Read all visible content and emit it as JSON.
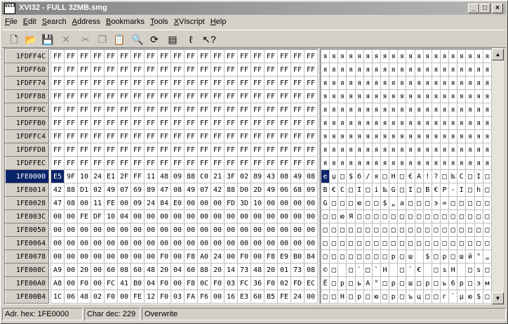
{
  "window": {
    "title": "XVI32 - FULL 32MB.smg",
    "app_icon_text": "XVI32"
  },
  "menu": [
    "File",
    "Edit",
    "Search",
    "Address",
    "Bookmarks",
    "Tools",
    "XVIscript",
    "Help"
  ],
  "toolbar": [
    {
      "name": "new-file-icon",
      "glyph": "🗋",
      "enabled": true
    },
    {
      "name": "open-folder-icon",
      "glyph": "📂",
      "enabled": true
    },
    {
      "name": "save-icon",
      "glyph": "💾",
      "enabled": true
    },
    {
      "name": "close-icon",
      "glyph": "✕",
      "enabled": false
    },
    {
      "name": "cut-icon",
      "glyph": "✂",
      "enabled": false
    },
    {
      "name": "copy-icon",
      "glyph": "❐",
      "enabled": false
    },
    {
      "name": "paste-icon",
      "glyph": "📋",
      "enabled": false
    },
    {
      "name": "search-icon",
      "glyph": "🔍",
      "enabled": true
    },
    {
      "name": "replace-icon",
      "glyph": "⟳",
      "enabled": true
    },
    {
      "name": "properties-icon",
      "glyph": "▤",
      "enabled": true
    },
    {
      "name": "script-icon",
      "glyph": "ℓ",
      "enabled": true
    },
    {
      "name": "help-icon",
      "glyph": "↖?",
      "enabled": true
    }
  ],
  "current_row": 9,
  "current_col": 0,
  "rows": [
    {
      "addr": "1FDFF4C",
      "hex": [
        "FF",
        "FF",
        "FF",
        "FF",
        "FF",
        "FF",
        "FF",
        "FF",
        "FF",
        "FF",
        "FF",
        "FF",
        "FF",
        "FF",
        "FF",
        "FF",
        "FF",
        "FF",
        "FF",
        "FF"
      ],
      "ascii": [
        "я",
        "я",
        "я",
        "я",
        "я",
        "я",
        "я",
        "я",
        "я",
        "я",
        "я",
        "я",
        "я",
        "я",
        "я",
        "я",
        "я",
        "я",
        "я",
        "я"
      ]
    },
    {
      "addr": "1FDFF60",
      "hex": [
        "FF",
        "FF",
        "FF",
        "FF",
        "FF",
        "FF",
        "FF",
        "FF",
        "FF",
        "FF",
        "FF",
        "FF",
        "FF",
        "FF",
        "FF",
        "FF",
        "FF",
        "FF",
        "FF",
        "FF"
      ],
      "ascii": [
        "я",
        "я",
        "я",
        "я",
        "я",
        "я",
        "я",
        "я",
        "я",
        "я",
        "я",
        "я",
        "я",
        "я",
        "я",
        "я",
        "я",
        "я",
        "я",
        "я"
      ]
    },
    {
      "addr": "1FDFF74",
      "hex": [
        "FF",
        "FF",
        "FF",
        "FF",
        "FF",
        "FF",
        "FF",
        "FF",
        "FF",
        "FF",
        "FF",
        "FF",
        "FF",
        "FF",
        "FF",
        "FF",
        "FF",
        "FF",
        "FF",
        "FF"
      ],
      "ascii": [
        "я",
        "я",
        "я",
        "я",
        "я",
        "я",
        "я",
        "я",
        "я",
        "я",
        "я",
        "я",
        "я",
        "я",
        "я",
        "я",
        "я",
        "я",
        "я",
        "я"
      ]
    },
    {
      "addr": "1FDFF88",
      "hex": [
        "FF",
        "FF",
        "FF",
        "FF",
        "FF",
        "FF",
        "FF",
        "FF",
        "FF",
        "FF",
        "FF",
        "FF",
        "FF",
        "FF",
        "FF",
        "FF",
        "FF",
        "FF",
        "FF",
        "FF"
      ],
      "ascii": [
        "я",
        "я",
        "я",
        "я",
        "я",
        "я",
        "я",
        "я",
        "я",
        "я",
        "я",
        "я",
        "я",
        "я",
        "я",
        "я",
        "я",
        "я",
        "я",
        "я"
      ]
    },
    {
      "addr": "1FDFF9C",
      "hex": [
        "FF",
        "FF",
        "FF",
        "FF",
        "FF",
        "FF",
        "FF",
        "FF",
        "FF",
        "FF",
        "FF",
        "FF",
        "FF",
        "FF",
        "FF",
        "FF",
        "FF",
        "FF",
        "FF",
        "FF"
      ],
      "ascii": [
        "я",
        "я",
        "я",
        "я",
        "я",
        "я",
        "я",
        "я",
        "я",
        "я",
        "я",
        "я",
        "я",
        "я",
        "я",
        "я",
        "я",
        "я",
        "я",
        "я"
      ]
    },
    {
      "addr": "1FDFFB0",
      "hex": [
        "FF",
        "FF",
        "FF",
        "FF",
        "FF",
        "FF",
        "FF",
        "FF",
        "FF",
        "FF",
        "FF",
        "FF",
        "FF",
        "FF",
        "FF",
        "FF",
        "FF",
        "FF",
        "FF",
        "FF"
      ],
      "ascii": [
        "я",
        "я",
        "я",
        "я",
        "я",
        "я",
        "я",
        "я",
        "я",
        "я",
        "я",
        "я",
        "я",
        "я",
        "я",
        "я",
        "я",
        "я",
        "я",
        "я"
      ]
    },
    {
      "addr": "1FDFFC4",
      "hex": [
        "FF",
        "FF",
        "FF",
        "FF",
        "FF",
        "FF",
        "FF",
        "FF",
        "FF",
        "FF",
        "FF",
        "FF",
        "FF",
        "FF",
        "FF",
        "FF",
        "FF",
        "FF",
        "FF",
        "FF"
      ],
      "ascii": [
        "я",
        "я",
        "я",
        "я",
        "я",
        "я",
        "я",
        "я",
        "я",
        "я",
        "я",
        "я",
        "я",
        "я",
        "я",
        "я",
        "я",
        "я",
        "я",
        "я"
      ]
    },
    {
      "addr": "1FDFFD8",
      "hex": [
        "FF",
        "FF",
        "FF",
        "FF",
        "FF",
        "FF",
        "FF",
        "FF",
        "FF",
        "FF",
        "FF",
        "FF",
        "FF",
        "FF",
        "FF",
        "FF",
        "FF",
        "FF",
        "FF",
        "FF"
      ],
      "ascii": [
        "я",
        "я",
        "я",
        "я",
        "я",
        "я",
        "я",
        "я",
        "я",
        "я",
        "я",
        "я",
        "я",
        "я",
        "я",
        "я",
        "я",
        "я",
        "я",
        "я"
      ]
    },
    {
      "addr": "1FDFFEC",
      "hex": [
        "FF",
        "FF",
        "FF",
        "FF",
        "FF",
        "FF",
        "FF",
        "FF",
        "FF",
        "FF",
        "FF",
        "FF",
        "FF",
        "FF",
        "FF",
        "FF",
        "FF",
        "FF",
        "FF",
        "FF"
      ],
      "ascii": [
        "я",
        "я",
        "я",
        "я",
        "я",
        "я",
        "я",
        "я",
        "я",
        "я",
        "я",
        "я",
        "я",
        "я",
        "я",
        "я",
        "я",
        "я",
        "я",
        "я"
      ]
    },
    {
      "addr": "1FE0000",
      "hex": [
        "E5",
        "9F",
        "10",
        "24",
        "E1",
        "2F",
        "FF",
        "11",
        "48",
        "09",
        "88",
        "C0",
        "21",
        "3F",
        "02",
        "89",
        "43",
        "08",
        "49",
        "08"
      ],
      "ascii": [
        "е",
        "џ",
        "□",
        "$",
        "б",
        "/",
        "я",
        "□",
        "H",
        "□",
        "€",
        "А",
        "!",
        "?",
        "□",
        "‰",
        "C",
        "□",
        "I",
        "□"
      ]
    },
    {
      "addr": "1FE0014",
      "hex": [
        "42",
        "88",
        "D1",
        "02",
        "49",
        "07",
        "69",
        "89",
        "47",
        "08",
        "49",
        "07",
        "42",
        "88",
        "D0",
        "2D",
        "49",
        "06",
        "68",
        "09"
      ],
      "ascii": [
        "B",
        "€",
        "С",
        "□",
        "I",
        "□",
        "i",
        "‰",
        "G",
        "□",
        "I",
        "□",
        "B",
        "€",
        "Р",
        "-",
        "I",
        "□",
        "h",
        "□"
      ]
    },
    {
      "addr": "1FE0028",
      "hex": [
        "47",
        "08",
        "00",
        "11",
        "FE",
        "00",
        "09",
        "24",
        "84",
        "E0",
        "00",
        "00",
        "00",
        "FD",
        "3D",
        "10",
        "00",
        "00",
        "00",
        "00"
      ],
      "ascii": [
        "G",
        "□",
        "□",
        "□",
        "ю",
        "□",
        "□",
        "$",
        "„",
        "а",
        "□",
        "□",
        "□",
        "э",
        "=",
        "□",
        "□",
        "□",
        "□",
        "□"
      ]
    },
    {
      "addr": "1FE003C",
      "hex": [
        "00",
        "00",
        "FE",
        "DF",
        "10",
        "04",
        "00",
        "00",
        "00",
        "00",
        "00",
        "00",
        "00",
        "00",
        "00",
        "00",
        "00",
        "00",
        "00",
        "00"
      ],
      "ascii": [
        "□",
        "□",
        "ю",
        "Я",
        "□",
        "□",
        "□",
        "□",
        "□",
        "□",
        "□",
        "□",
        "□",
        "□",
        "□",
        "□",
        "□",
        "□",
        "□",
        "□"
      ]
    },
    {
      "addr": "1FE0050",
      "hex": [
        "00",
        "00",
        "00",
        "00",
        "00",
        "00",
        "00",
        "00",
        "00",
        "00",
        "00",
        "00",
        "00",
        "00",
        "00",
        "00",
        "00",
        "00",
        "00",
        "00"
      ],
      "ascii": [
        "□",
        "□",
        "□",
        "□",
        "□",
        "□",
        "□",
        "□",
        "□",
        "□",
        "□",
        "□",
        "□",
        "□",
        "□",
        "□",
        "□",
        "□",
        "□",
        "□"
      ]
    },
    {
      "addr": "1FE0064",
      "hex": [
        "00",
        "00",
        "00",
        "00",
        "00",
        "00",
        "00",
        "00",
        "00",
        "00",
        "00",
        "00",
        "00",
        "00",
        "00",
        "00",
        "00",
        "00",
        "00",
        "00"
      ],
      "ascii": [
        "□",
        "□",
        "□",
        "□",
        "□",
        "□",
        "□",
        "□",
        "□",
        "□",
        "□",
        "□",
        "□",
        "□",
        "□",
        "□",
        "□",
        "□",
        "□",
        "□"
      ]
    },
    {
      "addr": "1FE0078",
      "hex": [
        "00",
        "00",
        "00",
        "00",
        "00",
        "00",
        "00",
        "00",
        "F0",
        "00",
        "F8",
        "A0",
        "24",
        "00",
        "F0",
        "00",
        "F8",
        "E9",
        "B0",
        "84"
      ],
      "ascii": [
        "□",
        "□",
        "□",
        "□",
        "□",
        "□",
        "□",
        "□",
        "р",
        "□",
        "ш",
        " ",
        "$",
        "□",
        "р",
        "□",
        "ш",
        "й",
        "°",
        "„"
      ]
    },
    {
      "addr": "1FE008C",
      "hex": [
        "A9",
        "00",
        "20",
        "00",
        "60",
        "08",
        "60",
        "48",
        "20",
        "04",
        "60",
        "88",
        "20",
        "14",
        "73",
        "48",
        "20",
        "01",
        "73",
        "08"
      ],
      "ascii": [
        "©",
        "□",
        " ",
        "□",
        "`",
        "□",
        "`",
        "H",
        " ",
        "□",
        "`",
        "€",
        " ",
        "□",
        "s",
        "H",
        " ",
        "□",
        "s",
        "□"
      ]
    },
    {
      "addr": "1FE00A0",
      "hex": [
        "A8",
        "00",
        "F0",
        "00",
        "FC",
        "41",
        "B0",
        "04",
        "F0",
        "00",
        "F8",
        "0C",
        "F0",
        "03",
        "FC",
        "36",
        "F0",
        "02",
        "FD",
        "EC"
      ],
      "ascii": [
        "Ё",
        "□",
        "р",
        "□",
        "ь",
        "A",
        "°",
        "□",
        "р",
        "□",
        "ш",
        "□",
        "р",
        "□",
        "ь",
        "6",
        "р",
        "□",
        "э",
        "м"
      ]
    },
    {
      "addr": "1FE00B4",
      "hex": [
        "1C",
        "06",
        "48",
        "02",
        "F0",
        "00",
        "FE",
        "12",
        "F0",
        "03",
        "FA",
        "F6",
        "00",
        "16",
        "E3",
        "60",
        "B5",
        "FE",
        "24",
        "00"
      ],
      "ascii": [
        "□",
        "□",
        "H",
        "□",
        "р",
        "□",
        "ю",
        "□",
        "р",
        "□",
        "ъ",
        "ц",
        "□",
        "□",
        "г",
        "`",
        "µ",
        "ю",
        "$",
        "□"
      ]
    }
  ],
  "status": {
    "address": "Adr. hex: 1FE0000",
    "char": "Char dec: 229",
    "mode": "Overwrite"
  }
}
